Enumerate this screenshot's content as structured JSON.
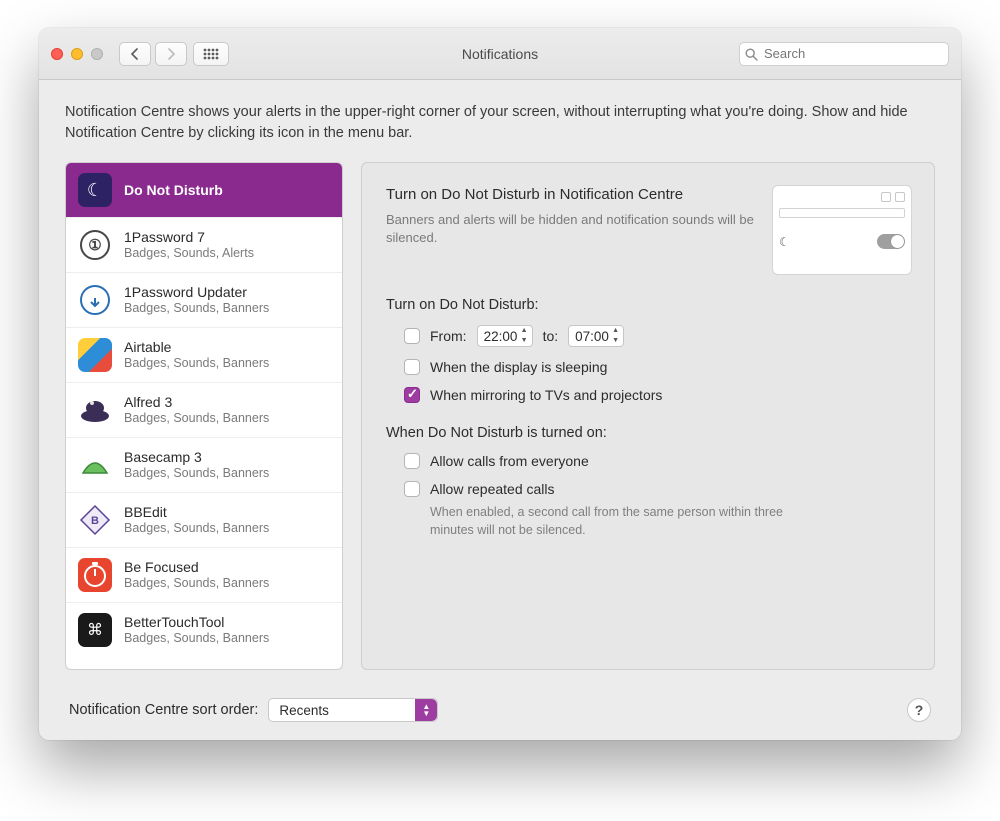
{
  "window": {
    "title": "Notifications"
  },
  "search": {
    "placeholder": "Search"
  },
  "intro": "Notification Centre shows your alerts in the upper-right corner of your screen, without interrupting what you're doing. Show and hide Notification Centre by clicking its icon in the menu bar.",
  "apps": [
    {
      "name": "Do Not Disturb",
      "sub": "",
      "selected": true,
      "icon": "moon-icon"
    },
    {
      "name": "1Password 7",
      "sub": "Badges, Sounds, Alerts",
      "icon": "1password-icon"
    },
    {
      "name": "1Password Updater",
      "sub": "Badges, Sounds, Banners",
      "icon": "1password-updater-icon"
    },
    {
      "name": "Airtable",
      "sub": "Badges, Sounds, Banners",
      "icon": "airtable-icon"
    },
    {
      "name": "Alfred 3",
      "sub": "Badges, Sounds, Banners",
      "icon": "alfred-icon"
    },
    {
      "name": "Basecamp 3",
      "sub": "Badges, Sounds, Banners",
      "icon": "basecamp-icon"
    },
    {
      "name": "BBEdit",
      "sub": "Badges, Sounds, Banners",
      "icon": "bbedit-icon"
    },
    {
      "name": "Be Focused",
      "sub": "Badges, Sounds, Banners",
      "icon": "befocused-icon"
    },
    {
      "name": "BetterTouchTool",
      "sub": "Badges, Sounds, Banners",
      "icon": "bettertouchtool-icon"
    }
  ],
  "settings": {
    "heading": "Turn on Do Not Disturb in Notification Centre",
    "subheading": "Banners and alerts will be hidden and notification sounds will be silenced.",
    "section1_label": "Turn on Do Not Disturb:",
    "from_label": "From:",
    "from_time": "22:00",
    "to_label": "to:",
    "to_time": "07:00",
    "opt_from_checked": false,
    "opt_sleep_label": "When the display is sleeping",
    "opt_sleep_checked": false,
    "opt_mirror_label": "When mirroring to TVs and projectors",
    "opt_mirror_checked": true,
    "section2_label": "When Do Not Disturb is turned on:",
    "opt_calls_label": "Allow calls from everyone",
    "opt_calls_checked": false,
    "opt_repeat_label": "Allow repeated calls",
    "opt_repeat_checked": false,
    "repeat_note": "When enabled, a second call from the same person within three minutes will not be silenced."
  },
  "footer": {
    "label": "Notification Centre sort order:",
    "value": "Recents"
  }
}
